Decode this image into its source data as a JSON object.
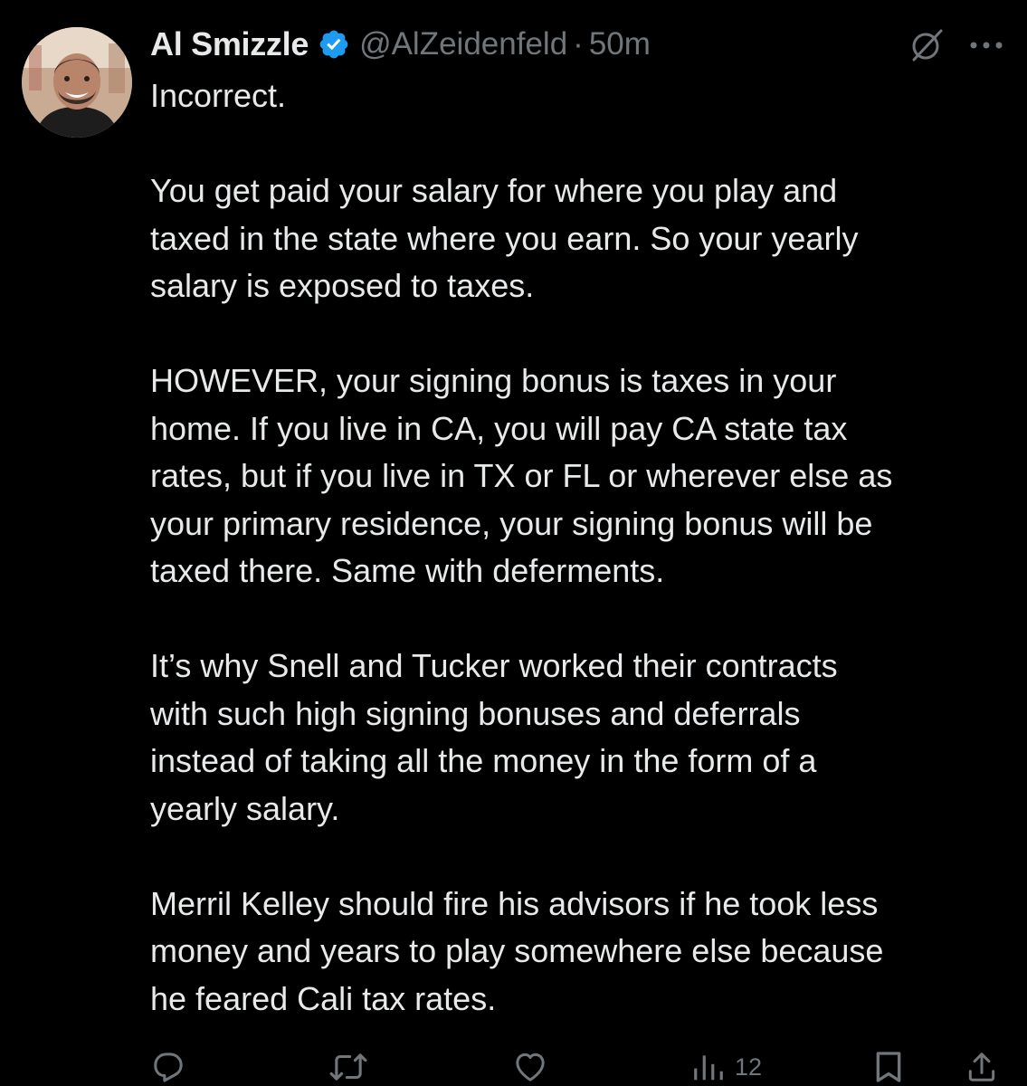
{
  "tweet": {
    "author_name": "Al Smizzle",
    "handle": "@AlZeidenfeld",
    "separator": "·",
    "time": "50m",
    "paragraphs": [
      "Incorrect.",
      "You get paid your salary for where you play and\ntaxed in the state where you earn. So your yearly\nsalary is exposed to taxes.",
      "HOWEVER, your signing bonus is taxes in your\nhome. If you live in CA, you will pay CA state tax\nrates, but if you live in TX or FL or wherever else as\nyour primary residence, your signing bonus will be\ntaxed there. Same with deferments.",
      "It’s why Snell and Tucker worked their contracts\nwith such high signing bonuses and deferrals\ninstead of taking all the money in the form of a\nyearly salary.",
      "Merril Kelley should fire his advisors if he took less\nmoney and years to play somewhere else because\nhe feared Cali tax rates."
    ],
    "actions": {
      "reply_icon": "reply-icon",
      "retweet_icon": "retweet-icon",
      "like_icon": "like-icon",
      "views_icon": "views-icon",
      "views_count": "12",
      "bookmark_icon": "bookmark-icon",
      "share_icon": "share-icon"
    }
  },
  "colors": {
    "background": "#000000",
    "text": "#e7e9ea",
    "secondary": "#71767b",
    "verified": "#1d9bf0"
  }
}
